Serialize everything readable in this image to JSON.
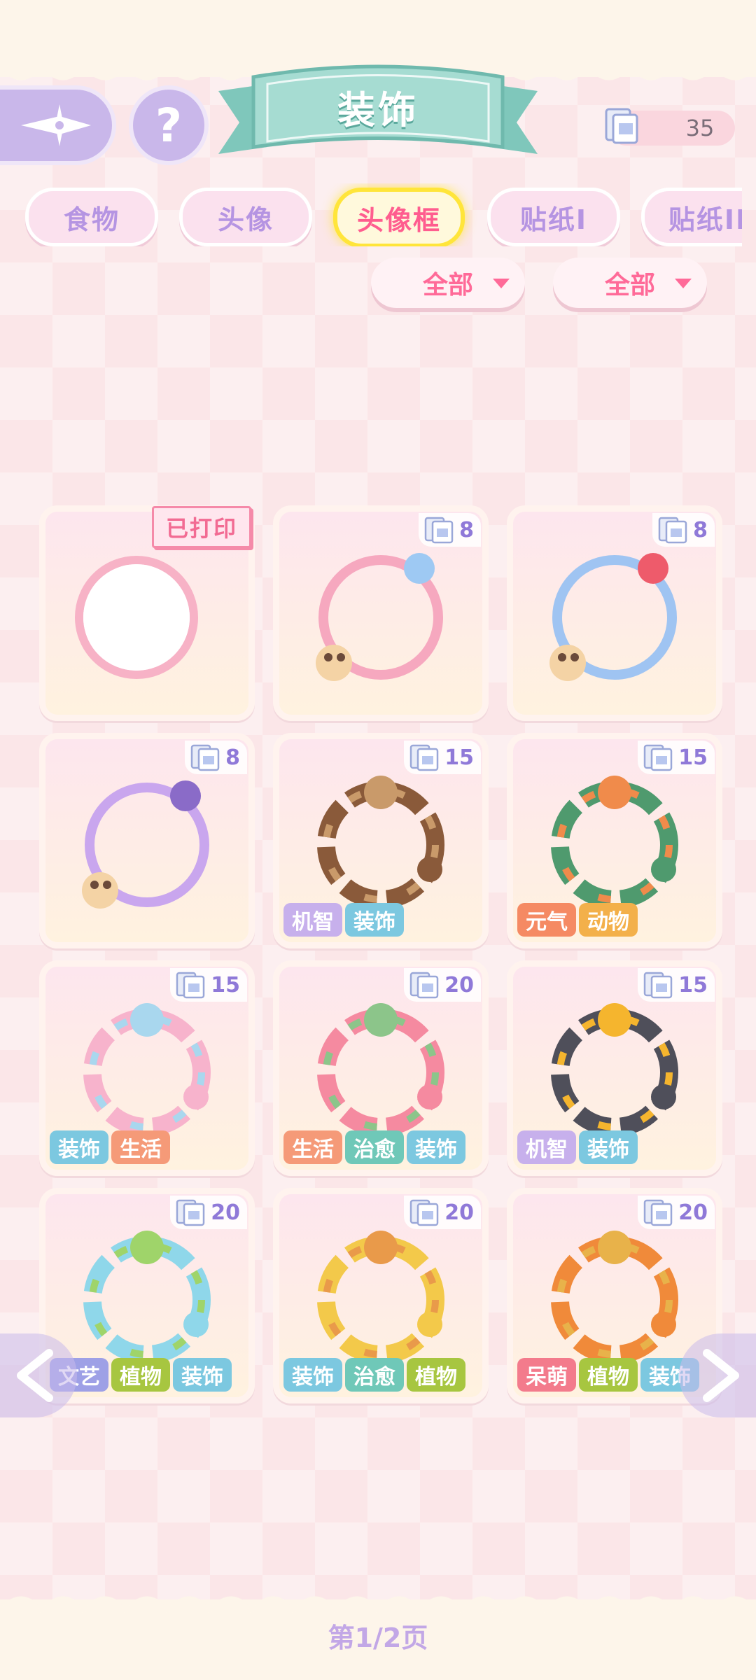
{
  "header": {
    "title": "装饰",
    "help_label": "?",
    "currency_value": "35"
  },
  "tabs": [
    {
      "label": "食物",
      "active": false
    },
    {
      "label": "头像",
      "active": false
    },
    {
      "label": "头像框",
      "active": true
    },
    {
      "label": "贴纸I",
      "active": false
    },
    {
      "label": "贴纸II",
      "active": false
    }
  ],
  "filters": [
    {
      "label": "全部"
    },
    {
      "label": "全部"
    }
  ],
  "colors": {
    "tag_机智": "#c7b0ec",
    "tag_装饰": "#7cc8e0",
    "tag_元气": "#f58a63",
    "tag_动物": "#f3b04a",
    "tag_生活": "#f59a78",
    "tag_治愈": "#6fc8b8",
    "tag_文艺": "#9ea0e6",
    "tag_植物": "#a7c640",
    "tag_呆萌": "#f37b8c"
  },
  "cards": [
    {
      "price": "",
      "printed_label": "已打印",
      "tags": [],
      "art": "plain-pink-ring"
    },
    {
      "price": "8",
      "tags": [],
      "art": "pink-bow-puppy-ring"
    },
    {
      "price": "8",
      "tags": [],
      "art": "blue-rose-puppy-ring"
    },
    {
      "price": "8",
      "tags": [],
      "art": "purple-cat-ring"
    },
    {
      "price": "15",
      "tags": [
        "机智",
        "装饰"
      ],
      "art": "detective-hat-frame"
    },
    {
      "price": "15",
      "tags": [
        "元气",
        "动物"
      ],
      "art": "green-dragon-frame"
    },
    {
      "price": "15",
      "tags": [
        "装饰",
        "生活"
      ],
      "art": "carnival-tent-frame"
    },
    {
      "price": "20",
      "tags": [
        "生活",
        "治愈",
        "装饰"
      ],
      "art": "cake-bunny-frame"
    },
    {
      "price": "15",
      "tags": [
        "机智",
        "装饰"
      ],
      "art": "hard-hat-frame"
    },
    {
      "price": "20",
      "tags": [
        "文艺",
        "植物",
        "装饰"
      ],
      "art": "lime-drink-frame"
    },
    {
      "price": "20",
      "tags": [
        "装饰",
        "治愈",
        "植物"
      ],
      "art": "ginkgo-cookie-frame"
    },
    {
      "price": "20",
      "tags": [
        "呆萌",
        "植物",
        "装饰"
      ],
      "art": "autumn-cat-frame"
    }
  ],
  "pagination": {
    "label": "第1/2页",
    "prev_icon": "chevron-left-icon",
    "next_icon": "chevron-right-icon"
  }
}
